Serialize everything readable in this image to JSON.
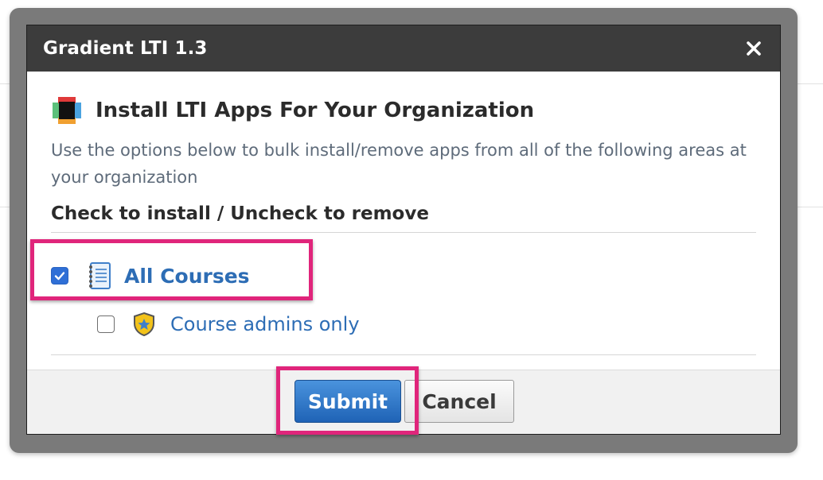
{
  "dialog": {
    "title": "Gradient LTI 1.3",
    "close_icon": "close-icon"
  },
  "content": {
    "heading": "Install LTI Apps For Your Organization",
    "description": "Use the options below to bulk install/remove apps from all of the following areas at your organization",
    "section_label": "Check to install / Uncheck to remove",
    "options": [
      {
        "label": "All Courses",
        "checked": true,
        "icon": "notebook-icon"
      },
      {
        "label": "Course admins only",
        "checked": false,
        "icon": "shield-star-icon"
      }
    ]
  },
  "footer": {
    "submit_label": "Submit",
    "cancel_label": "Cancel"
  },
  "colors": {
    "highlight": "#e0257b",
    "link": "#2d6db5",
    "titlebar": "#3c3c3c",
    "submit": "#2a72c6"
  }
}
